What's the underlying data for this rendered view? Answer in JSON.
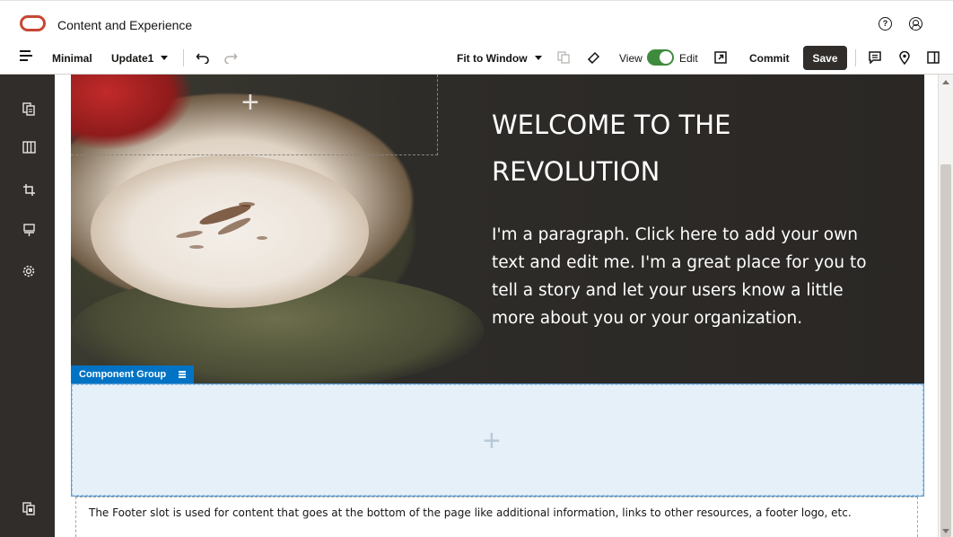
{
  "app": {
    "title": "Content and Experience"
  },
  "toolbar": {
    "layout_label": "Minimal",
    "update_label": "Update1",
    "fit_label": "Fit to Window",
    "view_label": "View",
    "edit_label": "Edit",
    "commit_label": "Commit",
    "save_label": "Save",
    "edit_mode_on": true
  },
  "icons": {
    "help": "help-icon",
    "user": "user-icon",
    "undo": "undo-icon",
    "redo": "redo-icon",
    "hamburger": "menu-icon"
  },
  "colors": {
    "brand": "#c74634",
    "rail": "#312d2a",
    "toggle_on": "#3f8b3d",
    "component_group": "#0073c4",
    "save_button": "#312d2a"
  },
  "hero": {
    "title": "WELCOME TO THE REVOLUTION",
    "text": "I'm a paragraph. Click here to add your own text and edit me. I'm a great place for you to tell a story and let your users know a little more about you or your organization."
  },
  "component_group": {
    "label": "Component Group"
  },
  "footer": {
    "text": "The Footer slot is used for content that goes at the bottom of the page like additional information, links to other resources, a footer logo, etc."
  }
}
